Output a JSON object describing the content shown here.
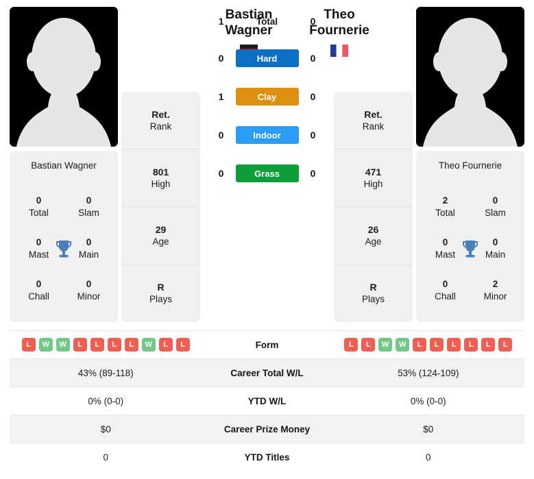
{
  "colors": {
    "hard": "#0d6fc4",
    "clay": "#dd9010",
    "indoor": "#2a9cf5",
    "grass": "#0f9d3a",
    "win": "#73c787",
    "loss": "#ef5f51",
    "trophy": "#4a7ebb",
    "card_bg": "#f0f0f0",
    "avatar_bg": "#000000"
  },
  "players": {
    "left": {
      "first_name": "Bastian",
      "last_name": "Wagner",
      "full_name": "Bastian Wagner",
      "country": "Germany",
      "flag_icon": "flag-germany-icon",
      "avatar_icon": "player-silhouette-icon",
      "rank": {
        "value": "Ret.",
        "label": "Rank"
      },
      "high": {
        "value": "801",
        "label": "High"
      },
      "age": {
        "value": "29",
        "label": "Age"
      },
      "plays": {
        "value": "R",
        "label": "Plays"
      },
      "titles": [
        {
          "num": "0",
          "label": "Total"
        },
        {
          "num": "0",
          "label": "Slam"
        },
        {
          "num": "0",
          "label": "Mast"
        },
        {
          "num": "0",
          "label": "Main"
        },
        {
          "num": "0",
          "label": "Chall"
        },
        {
          "num": "0",
          "label": "Minor"
        }
      ],
      "form": [
        "L",
        "W",
        "W",
        "L",
        "L",
        "L",
        "L",
        "W",
        "L",
        "L"
      ],
      "career_total_wl": "43% (89-118)",
      "ytd_wl": "0% (0-0)",
      "career_prize_money": "$0",
      "ytd_titles": "0"
    },
    "right": {
      "first_name": "Theo",
      "last_name": "Fournerie",
      "full_name": "Theo Fournerie",
      "country": "France",
      "flag_icon": "flag-france-icon",
      "avatar_icon": "player-silhouette-icon",
      "rank": {
        "value": "Ret.",
        "label": "Rank"
      },
      "high": {
        "value": "471",
        "label": "High"
      },
      "age": {
        "value": "26",
        "label": "Age"
      },
      "plays": {
        "value": "R",
        "label": "Plays"
      },
      "titles": [
        {
          "num": "2",
          "label": "Total"
        },
        {
          "num": "0",
          "label": "Slam"
        },
        {
          "num": "0",
          "label": "Mast"
        },
        {
          "num": "0",
          "label": "Main"
        },
        {
          "num": "0",
          "label": "Chall"
        },
        {
          "num": "2",
          "label": "Minor"
        }
      ],
      "form": [
        "L",
        "L",
        "W",
        "W",
        "L",
        "L",
        "L",
        "L",
        "L",
        "L"
      ],
      "career_total_wl": "53% (124-109)",
      "ytd_wl": "0% (0-0)",
      "career_prize_money": "$0",
      "ytd_titles": "0"
    }
  },
  "head_to_head": [
    {
      "label": "Total",
      "left": "1",
      "right": "0",
      "surface": false
    },
    {
      "label": "Hard",
      "left": "0",
      "right": "0",
      "surface": true
    },
    {
      "label": "Clay",
      "left": "1",
      "right": "0",
      "surface": true
    },
    {
      "label": "Indoor",
      "left": "0",
      "right": "0",
      "surface": true
    },
    {
      "label": "Grass",
      "left": "0",
      "right": "0",
      "surface": true
    }
  ],
  "table_rows": [
    {
      "label": "Form",
      "left": "",
      "right": ""
    },
    {
      "label": "Career Total W/L",
      "left": "43% (89-118)",
      "right": "53% (124-109)"
    },
    {
      "label": "YTD W/L",
      "left": "0% (0-0)",
      "right": "0% (0-0)"
    },
    {
      "label": "Career Prize Money",
      "left": "$0",
      "right": "$0"
    },
    {
      "label": "YTD Titles",
      "left": "0",
      "right": "0"
    }
  ]
}
